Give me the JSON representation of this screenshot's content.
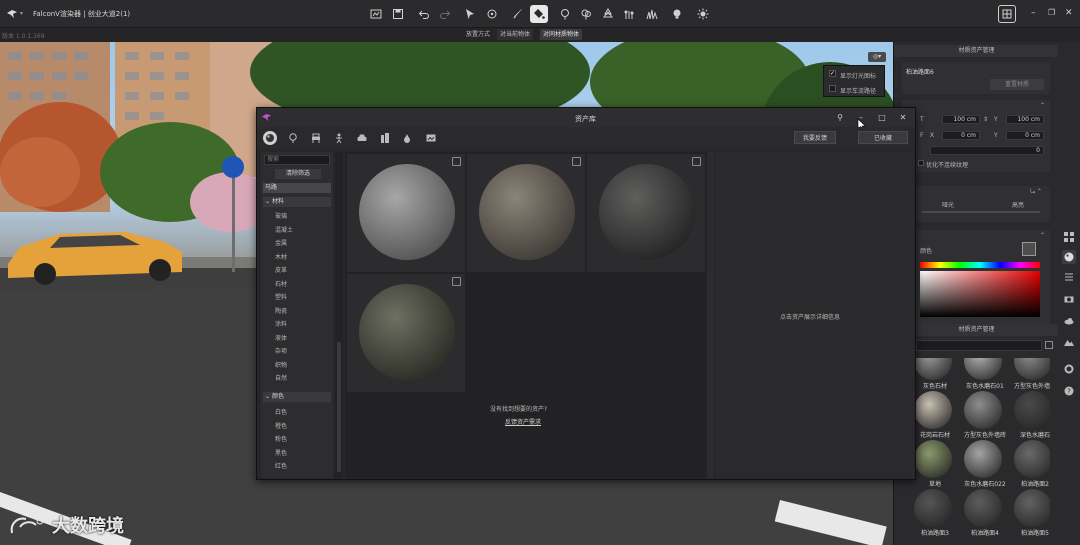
{
  "app": {
    "title": "FalconV渲染器 | 创业大道2(1)",
    "version": "版本 1.0.1.169"
  },
  "modes": {
    "label": "放置方式",
    "items": [
      "对当前物体",
      "对同材质物体"
    ]
  },
  "toolbar": {
    "icons": [
      "scene-icon",
      "save-icon",
      "undo-icon",
      "redo-icon",
      "select-icon",
      "rotate-icon",
      "brush-icon",
      "paint-bucket-icon",
      "tree-icon",
      "tree-icon",
      "tree-icon",
      "tree-icon",
      "grass-icon",
      "light-icon",
      "sun-icon"
    ]
  },
  "viewport_menu": {
    "items": [
      "显示灯光图标",
      "显示车流路径"
    ]
  },
  "right_panel": {
    "header": "材质资产管理",
    "material_name": "柏油路面6",
    "reset_button": "重置材质",
    "size_w_label": "T",
    "size_x_label": "X",
    "size_y_label": "Y",
    "size_w_val": "100 cm",
    "size_h_val": "100 cm",
    "offset_x_label": "F",
    "offset_x_val": "0 cm",
    "offset_y_val": "0 cm",
    "rotate_val": "0",
    "optimize_label": "优化不连续纹理",
    "gloss_a": "哑光",
    "gloss_b": "高亮",
    "color_label": "颜色",
    "lib_header": "材质资产管理",
    "thumbs": [
      {
        "name": "灰色石材",
        "tone": "#9a9a9a"
      },
      {
        "name": "灰色水磨石01",
        "tone": "#b0b0b0"
      },
      {
        "name": "方型灰色外墙砖",
        "tone": "#8c8c8c"
      },
      {
        "name": "花岗岩石材",
        "tone": "#c8bfb2"
      },
      {
        "name": "方型灰色外墙砖",
        "tone": "#8e8e8e"
      },
      {
        "name": "深色水磨石",
        "tone": "#4a4a4a"
      },
      {
        "name": "草地",
        "tone": "#8a9a6a"
      },
      {
        "name": "灰色水磨石022",
        "tone": "#a4a4a4"
      },
      {
        "name": "柏油路面2",
        "tone": "#6a6a6a"
      },
      {
        "name": "柏油路面3",
        "tone": "#555"
      },
      {
        "name": "柏油路面4",
        "tone": "#5d5d5d"
      },
      {
        "name": "柏油路面5",
        "tone": "#626262"
      }
    ]
  },
  "dialog": {
    "title": "资产库",
    "feedback_button": "我要反馈",
    "collected_button": "已收藏",
    "search_placeholder": "搜索",
    "clear_filter": "清除筛选",
    "top_tag": "马路",
    "material_section": "材料",
    "materials": [
      "玻璃",
      "混凝土",
      "金属",
      "木材",
      "皮革",
      "石材",
      "塑料",
      "陶瓷",
      "涂料",
      "液体",
      "杂项",
      "织物",
      "自然"
    ],
    "color_section": "颜色",
    "colors": [
      "白色",
      "橙色",
      "粉色",
      "黑色",
      "红色"
    ],
    "not_found": "没有找到想要的资产?",
    "feedback_link": "反馈资产需求",
    "detail_hint": "点击资产展示详细信息",
    "assets": [
      {
        "tone_light": "#a7a7a7",
        "tone_dark": "#4d4d4d"
      },
      {
        "tone_light": "#8b8479",
        "tone_dark": "#3a3631"
      },
      {
        "tone_light": "#5f605e",
        "tone_dark": "#1f1f1f"
      },
      {
        "tone_light": "#6d7062",
        "tone_dark": "#262721"
      }
    ]
  },
  "watermark": "大数跨境"
}
